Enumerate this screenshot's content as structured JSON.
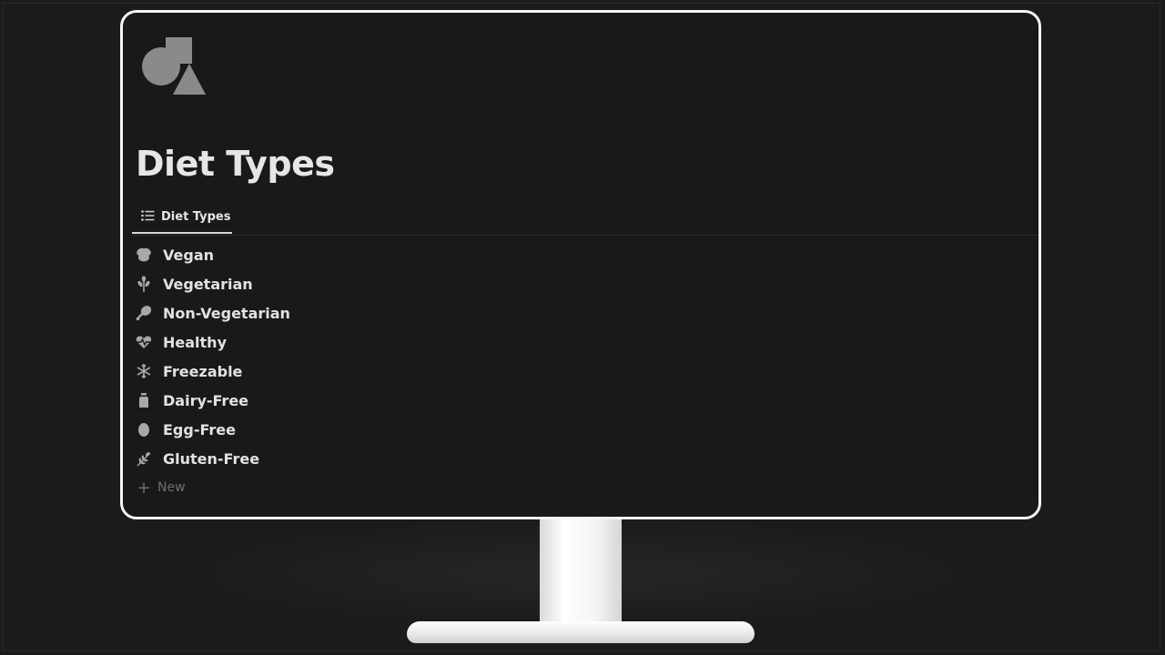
{
  "page": {
    "title": "Diet Types",
    "icon": "shapes-icon"
  },
  "tabs": [
    {
      "label": "Diet Types",
      "icon": "list-icon"
    }
  ],
  "items": [
    {
      "label": "Vegan",
      "icon": "leaf-cluster-icon"
    },
    {
      "label": "Vegetarian",
      "icon": "wheat-sprout-icon"
    },
    {
      "label": "Non-Vegetarian",
      "icon": "drumstick-icon"
    },
    {
      "label": "Healthy",
      "icon": "heartbeat-icon"
    },
    {
      "label": "Freezable",
      "icon": "snowflake-icon"
    },
    {
      "label": "Dairy-Free",
      "icon": "milk-carton-icon"
    },
    {
      "label": "Egg-Free",
      "icon": "egg-icon"
    },
    {
      "label": "Gluten-Free",
      "icon": "grain-icon"
    }
  ],
  "new_label": "New",
  "colors": {
    "background": "#191919",
    "text": "#e2e2e2",
    "muted": "#6e6e6e",
    "icon": "#a8a8a8"
  }
}
